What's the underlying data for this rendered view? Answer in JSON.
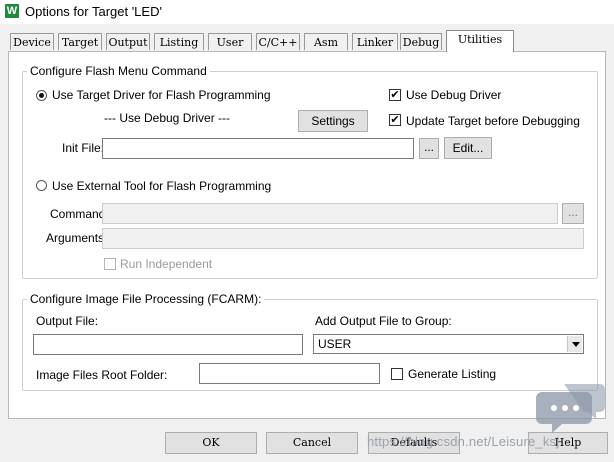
{
  "window": {
    "title": "Options for Target 'LED'",
    "icon_letter": "W"
  },
  "tabs": [
    {
      "label": "Device"
    },
    {
      "label": "Target"
    },
    {
      "label": "Output"
    },
    {
      "label": "Listing"
    },
    {
      "label": "User"
    },
    {
      "label": "C/C++"
    },
    {
      "label": "Asm"
    },
    {
      "label": "Linker"
    },
    {
      "label": "Debug"
    },
    {
      "label": "Utilities"
    }
  ],
  "active_tab": "Utilities",
  "flash_group": {
    "title": "Configure Flash Menu Command",
    "use_target_driver": {
      "label": "Use Target Driver for Flash Programming",
      "selected": true
    },
    "debug_driver_text": "--- Use Debug Driver ---",
    "settings_button": "Settings",
    "use_debug_driver": {
      "label": "Use Debug Driver",
      "checked": true
    },
    "update_target": {
      "label": "Update Target before Debugging",
      "checked": true
    },
    "init_file": {
      "label": "Init File:",
      "value": "",
      "browse_label": "...",
      "edit_label": "Edit..."
    },
    "use_external_tool": {
      "label": "Use External Tool for Flash Programming",
      "selected": false
    },
    "command": {
      "label": "Command:",
      "value": "",
      "browse_label": "..."
    },
    "arguments": {
      "label": "Arguments:",
      "value": ""
    },
    "run_independent": {
      "label": "Run Independent",
      "checked": false
    }
  },
  "image_group": {
    "title": "Configure Image File Processing (FCARM):",
    "output_file": {
      "label": "Output File:",
      "value": ""
    },
    "add_output": {
      "label": "Add Output File  to Group:",
      "selected": "USER"
    },
    "root_folder": {
      "label": "Image Files Root Folder:",
      "value": ""
    },
    "generate_listing": {
      "label": "Generate Listing",
      "checked": false
    }
  },
  "buttons": {
    "ok": "OK",
    "cancel": "Cancel",
    "defaults": "Defaults",
    "help": "Help"
  },
  "watermark": "https://blog.csdn.net/Leisure_ksj",
  "check_mark": "✔"
}
